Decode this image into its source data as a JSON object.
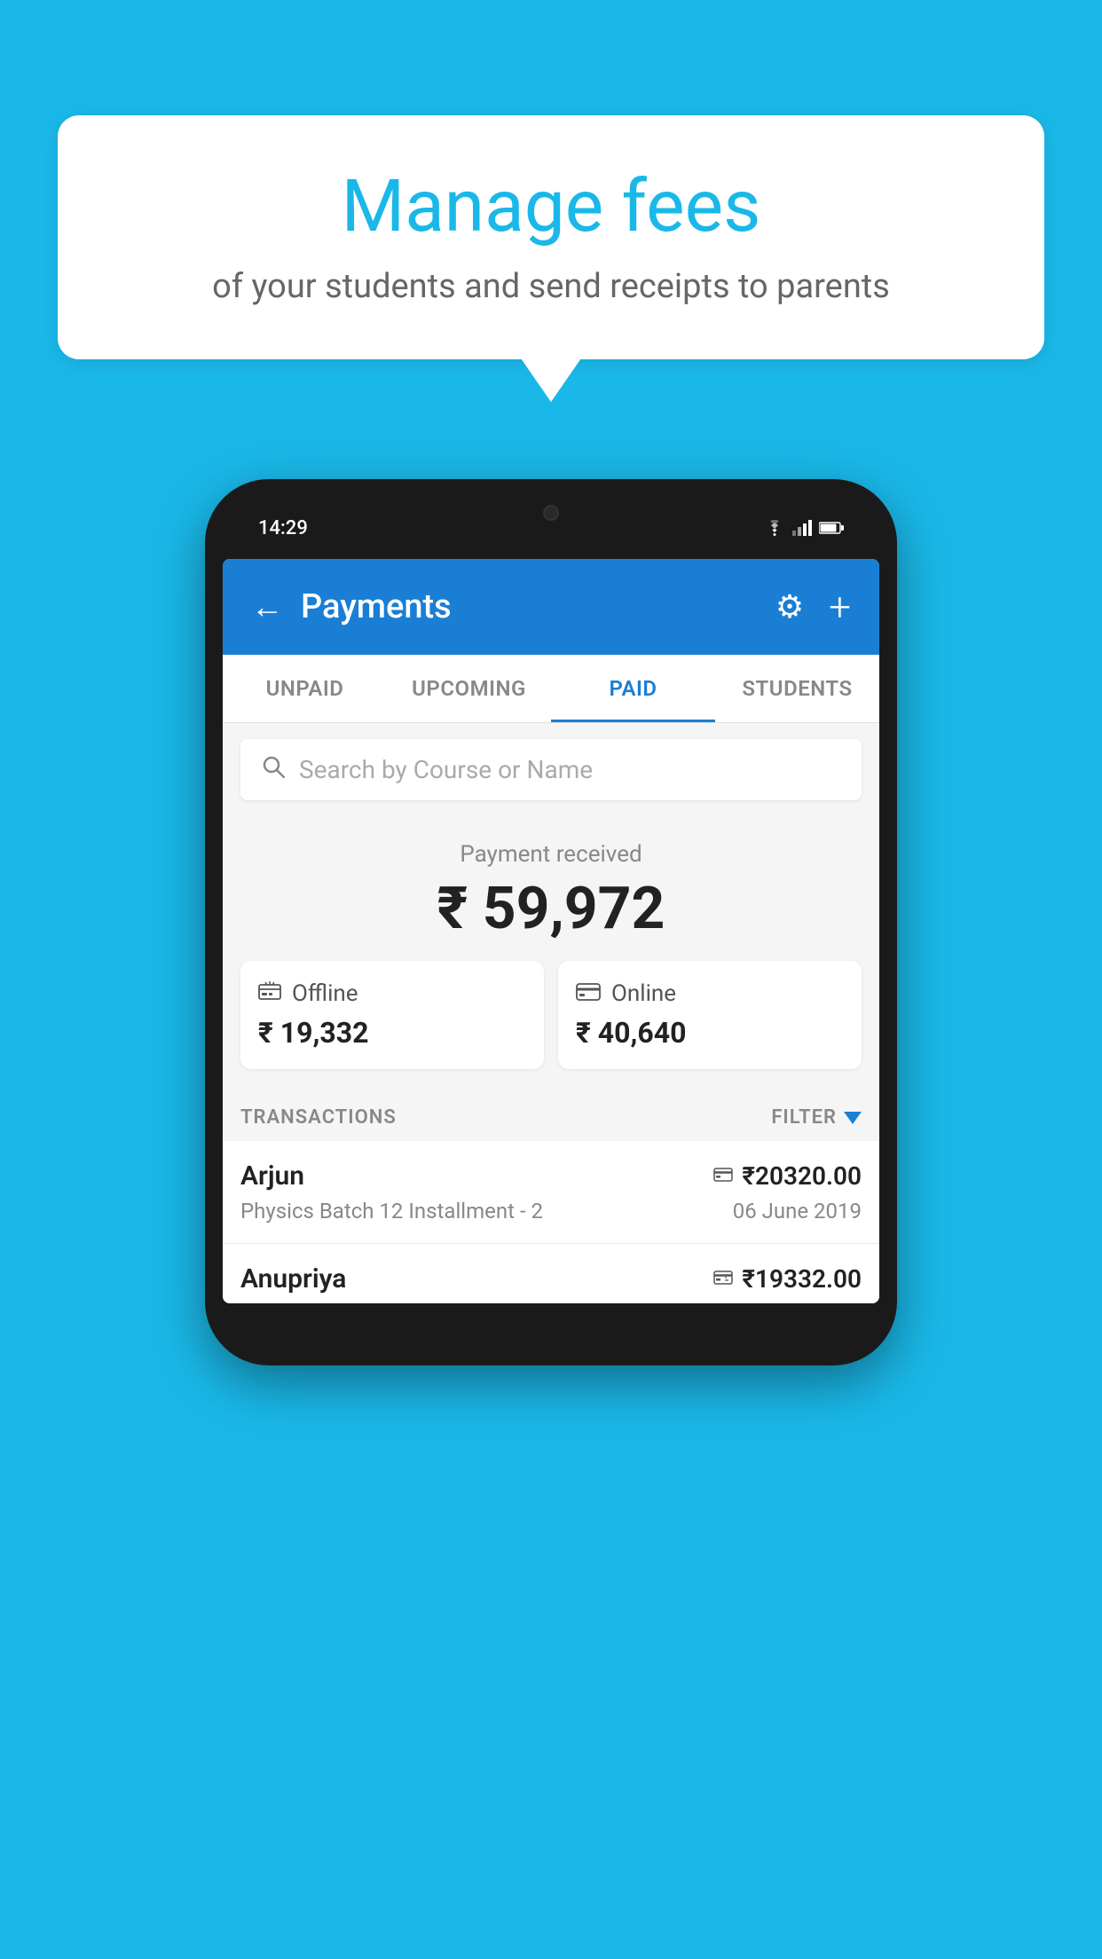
{
  "background_color": "#1ab8e8",
  "speech_bubble": {
    "title": "Manage fees",
    "subtitle": "of your students and send receipts to parents"
  },
  "status_bar": {
    "time": "14:29",
    "icons": "▲ ▲ ▌"
  },
  "header": {
    "title": "Payments",
    "back_label": "←",
    "gear_label": "⚙",
    "plus_label": "+"
  },
  "tabs": [
    {
      "label": "UNPAID",
      "active": false
    },
    {
      "label": "UPCOMING",
      "active": false
    },
    {
      "label": "PAID",
      "active": true
    },
    {
      "label": "STUDENTS",
      "active": false
    }
  ],
  "search": {
    "placeholder": "Search by Course or Name"
  },
  "payment_summary": {
    "label": "Payment received",
    "total": "₹ 59,972",
    "offline": {
      "label": "Offline",
      "amount": "₹ 19,332"
    },
    "online": {
      "label": "Online",
      "amount": "₹ 40,640"
    }
  },
  "transactions": {
    "header": "TRANSACTIONS",
    "filter_label": "FILTER",
    "rows": [
      {
        "name": "Arjun",
        "course": "Physics Batch 12 Installment - 2",
        "amount": "₹20320.00",
        "date": "06 June 2019",
        "mode": "card"
      },
      {
        "name": "Anupriya",
        "course": "",
        "amount": "₹19332.00",
        "date": "",
        "mode": "cash"
      }
    ]
  },
  "icons": {
    "search": "🔍",
    "gear": "⚙",
    "back_arrow": "←",
    "offline_icon": "🪙",
    "online_icon": "💳",
    "card_payment": "💳",
    "cash_payment": "💵",
    "filter_icon": "▼"
  }
}
